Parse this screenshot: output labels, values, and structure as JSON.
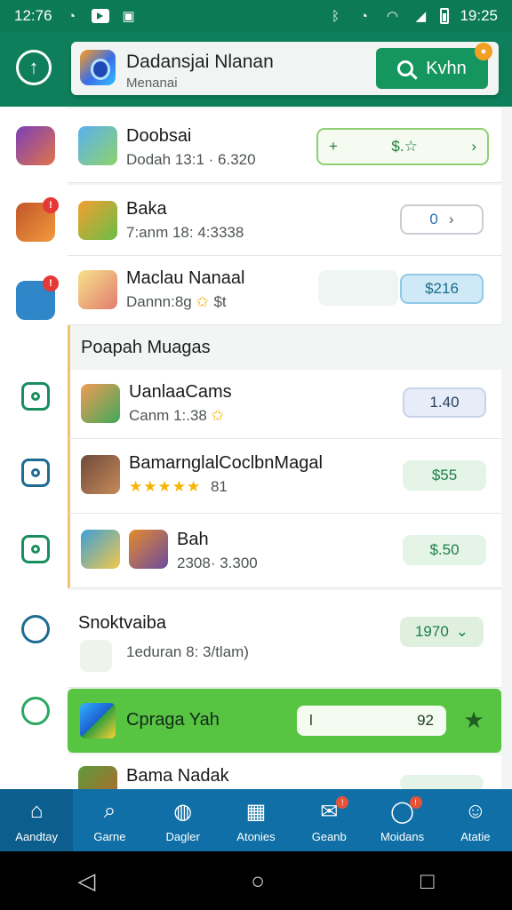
{
  "status_bar": {
    "time_left": "12:76",
    "time_right": "19:25",
    "icons_left": [
      "alarm-icon",
      "media-icon",
      "sim-icon"
    ],
    "icons_right": [
      "bluetooth-icon",
      "alarm-icon",
      "wifi-icon",
      "signal-icon",
      "battery-icon"
    ]
  },
  "header": {
    "app_title": "Dadansjai Nlanan",
    "app_subtitle": "Menanai",
    "search_button_label": "Kvhn"
  },
  "list": {
    "rows": [
      {
        "title": "Doobsai",
        "subtitle": "Dodah 13:1 · 6.320",
        "action": "$.☆",
        "action_prefix": "+"
      },
      {
        "title": "Baka",
        "subtitle": "7:anm 18: 4:3338",
        "action": "0"
      },
      {
        "title": "Maclau Nanaal",
        "subtitle": "Dannn:8g",
        "subtitle_extra": "$t",
        "action": "$216"
      }
    ],
    "section_title": "Poapah Muagas",
    "section_rows": [
      {
        "title": "UanlaaCams",
        "subtitle": "Canm 1:.38",
        "action": "1.40"
      },
      {
        "title": "BamarnglalCoclbnMagal",
        "subtitle": "81",
        "rating": "★★★★★",
        "action": "$55"
      },
      {
        "title": "Bah",
        "subtitle": "2308· 3.300",
        "action": "$.50"
      },
      {
        "title": "Snoktvaiba",
        "subtitle": "1eduran 8: 3/tlam)",
        "action": "1970"
      }
    ],
    "promo": {
      "title": "Cpraga Yah",
      "field_value": "l",
      "field_extra": "92"
    },
    "last_row": {
      "title": "Bama Nadak"
    }
  },
  "bottom_nav": [
    {
      "label": "Aandtay",
      "icon": "home-icon"
    },
    {
      "label": "Garne",
      "icon": "search-icon"
    },
    {
      "label": "Dagler",
      "icon": "compass-icon"
    },
    {
      "label": "Atonies",
      "icon": "grid-icon"
    },
    {
      "label": "Geanb",
      "icon": "mail-icon",
      "badge": "!"
    },
    {
      "label": "Moidans",
      "icon": "chat-icon",
      "badge": "!"
    },
    {
      "label": "Atatie",
      "icon": "profile-icon"
    }
  ],
  "colors": {
    "primary": "#0e7f5a",
    "nav": "#0f6fa6",
    "promo": "#57c442"
  }
}
